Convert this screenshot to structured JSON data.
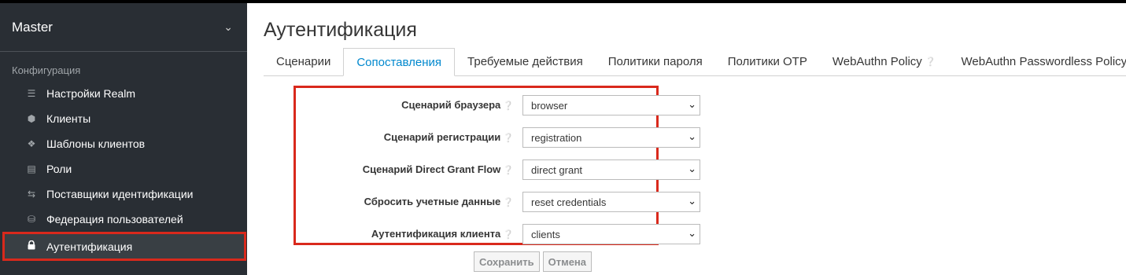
{
  "sidebar": {
    "realm_name": "Master",
    "section_label": "Конфигурация",
    "items": [
      {
        "label": "Настройки Realm"
      },
      {
        "label": "Клиенты"
      },
      {
        "label": "Шаблоны клиентов"
      },
      {
        "label": "Роли"
      },
      {
        "label": "Поставщики идентификации"
      },
      {
        "label": "Федерация пользователей"
      },
      {
        "label": "Аутентификация"
      }
    ]
  },
  "main": {
    "title": "Аутентификация",
    "tabs": [
      {
        "label": "Сценарии"
      },
      {
        "label": "Сопоставления"
      },
      {
        "label": "Требуемые действия"
      },
      {
        "label": "Политики пароля"
      },
      {
        "label": "Политики OTP"
      },
      {
        "label": "WebAuthn Policy"
      },
      {
        "label": "WebAuthn Passwordless Policy"
      }
    ],
    "active_tab": "Сопоставления",
    "form": {
      "rows": [
        {
          "label": "Сценарий браузера",
          "value": "browser"
        },
        {
          "label": "Сценарий регистрации",
          "value": "registration"
        },
        {
          "label": "Сценарий Direct Grant Flow",
          "value": "direct grant"
        },
        {
          "label": "Сбросить учетные данные",
          "value": "reset credentials"
        },
        {
          "label": "Аутентификация клиента",
          "value": "clients"
        }
      ],
      "save_label": "Сохранить",
      "cancel_label": "Отмена"
    }
  },
  "colors": {
    "sidebar_bg": "#292e34",
    "accent": "#0088ce",
    "highlight": "#d9291c"
  },
  "icons": {
    "realm_dropdown": "chevron-down-icon",
    "help": "question-circle-icon",
    "select_arrow": "chevron-down-icon"
  }
}
